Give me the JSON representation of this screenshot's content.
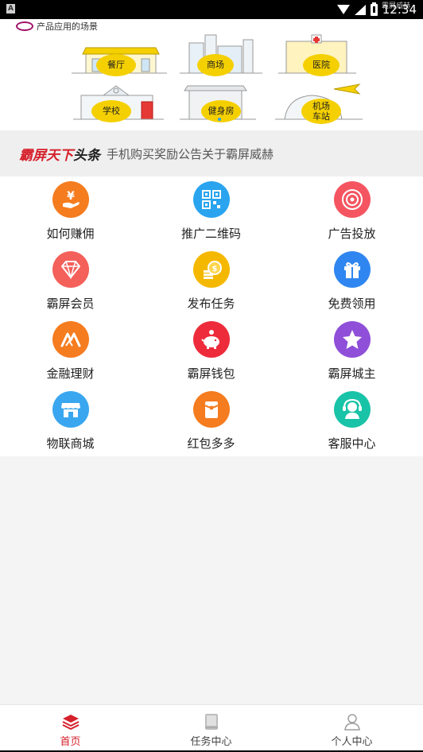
{
  "status_bar": {
    "time": "12:34",
    "notif_text": "霸屏威赫"
  },
  "banner": {
    "heading": "产品应用的场景",
    "scenes": [
      {
        "label": "餐厅",
        "icon": "restaurant-icon"
      },
      {
        "label": "商场",
        "icon": "mall-icon"
      },
      {
        "label": "医院",
        "icon": "hospital-icon"
      },
      {
        "label": "学校",
        "icon": "school-icon"
      },
      {
        "label": "健身房",
        "icon": "gym-icon"
      },
      {
        "label_line1": "机场",
        "label_line2": "车站",
        "icon": "airport-icon"
      }
    ]
  },
  "notice": {
    "brand_red": "霸屏天下",
    "brand_dark": "头条",
    "text": "手机购买奖励公告关于霸屏威赫"
  },
  "menu": [
    {
      "label": "如何赚佣",
      "icon": "earn-commission-icon",
      "color": "#f57c1f"
    },
    {
      "label": "推广二维码",
      "icon": "qr-code-icon",
      "color": "#2aa4ef"
    },
    {
      "label": "广告投放",
      "icon": "target-icon",
      "color": "#f45560"
    },
    {
      "label": "霸屏会员",
      "icon": "diamond-icon",
      "color": "#f4605a"
    },
    {
      "label": "发布任务",
      "icon": "coins-icon",
      "color": "#f5b800"
    },
    {
      "label": "免费领用",
      "icon": "gift-icon",
      "color": "#2f86f0"
    },
    {
      "label": "金融理财",
      "icon": "finance-icon",
      "color": "#f57c1f"
    },
    {
      "label": "霸屏钱包",
      "icon": "piggy-bank-icon",
      "color": "#ee2b3b"
    },
    {
      "label": "霸屏城主",
      "icon": "star-icon",
      "color": "#8f4fd9"
    },
    {
      "label": "物联商城",
      "icon": "store-icon",
      "color": "#3aa6f0"
    },
    {
      "label": "红包多多",
      "icon": "red-envelope-icon",
      "color": "#f57c1f"
    },
    {
      "label": "客服中心",
      "icon": "customer-service-icon",
      "color": "#19c3a7"
    }
  ],
  "bottom_nav": [
    {
      "label": "首页",
      "icon": "home-layers-icon",
      "active": true
    },
    {
      "label": "任务中心",
      "icon": "book-icon",
      "active": false
    },
    {
      "label": "个人中心",
      "icon": "person-icon",
      "active": false
    }
  ],
  "colors": {
    "accent": "#d6202b",
    "banner_bubble": "#f5d000"
  }
}
